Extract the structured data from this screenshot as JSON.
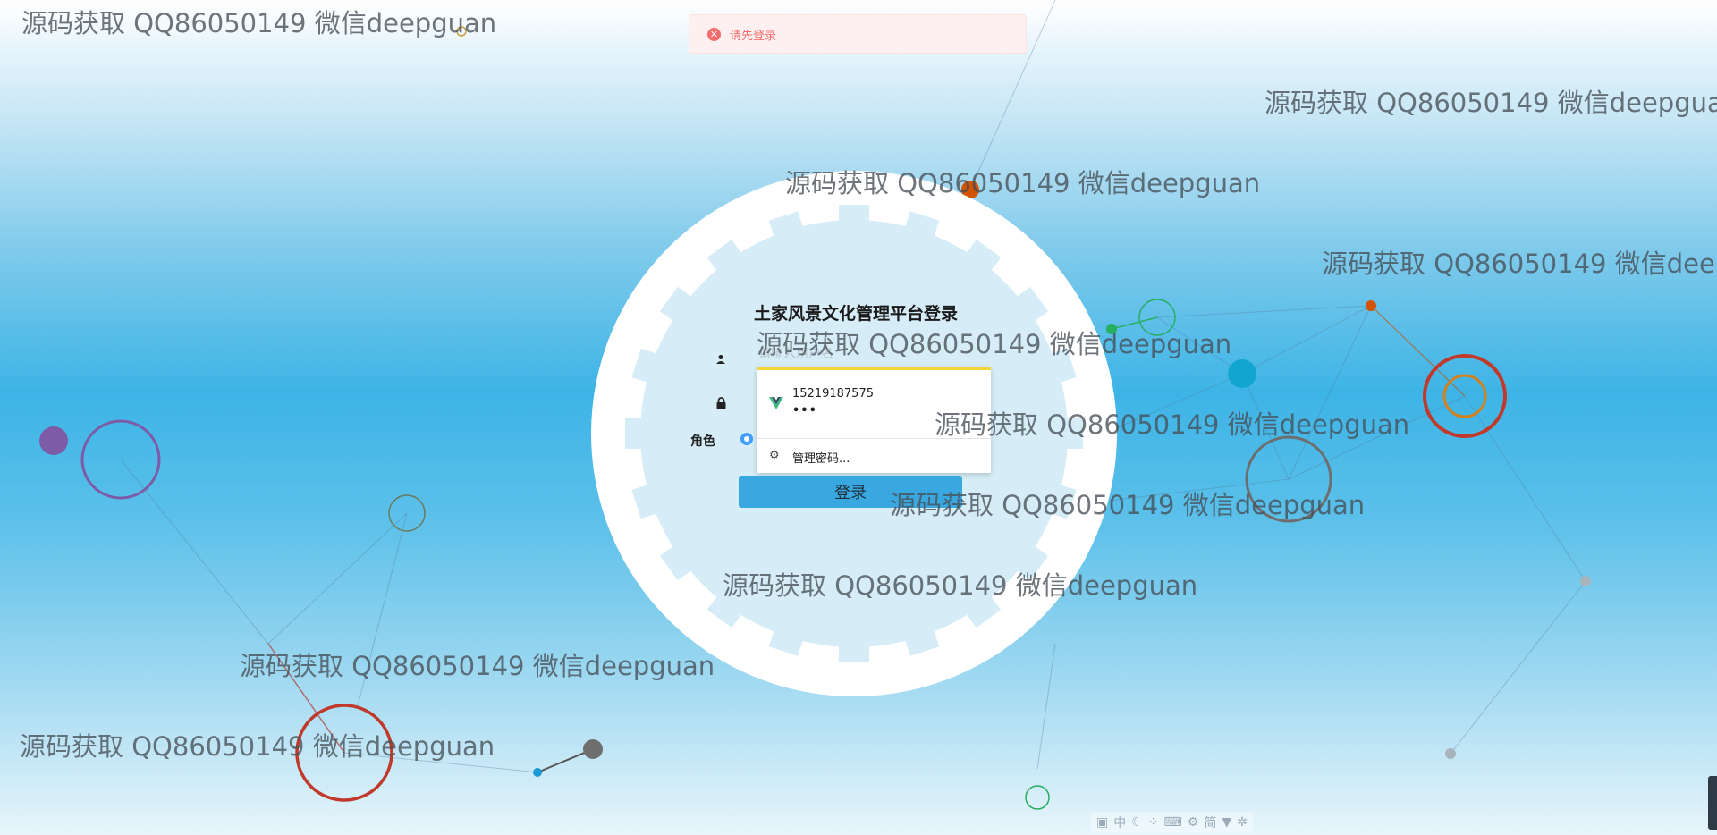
{
  "toast": {
    "message": "请先登录",
    "type": "error",
    "icon": "circle-x-icon"
  },
  "login": {
    "title": "土家风景文化管理平台登录",
    "username_placeholder": "请输入用户名",
    "role_label": "角色",
    "submit_label": "登录"
  },
  "autofill": {
    "saved_username": "15219187575",
    "saved_password_mask": "•••",
    "manage_label": "管理密码..."
  },
  "watermark": "源码获取 QQ86050149 微信deepguan",
  "ime_toolbar": {
    "lang": "中",
    "mode": "简",
    "items": [
      "logo-icon",
      "moon-icon",
      "dots-icon",
      "keyboard-icon",
      "settings-icon",
      "shirt-icon",
      "gear-icon"
    ]
  },
  "colors": {
    "accent": "#3aa8e0",
    "error_bg": "#fef0f0",
    "error_text": "#f56c6c",
    "radio": "#409eff",
    "autofill_border": "#f0d43a"
  }
}
